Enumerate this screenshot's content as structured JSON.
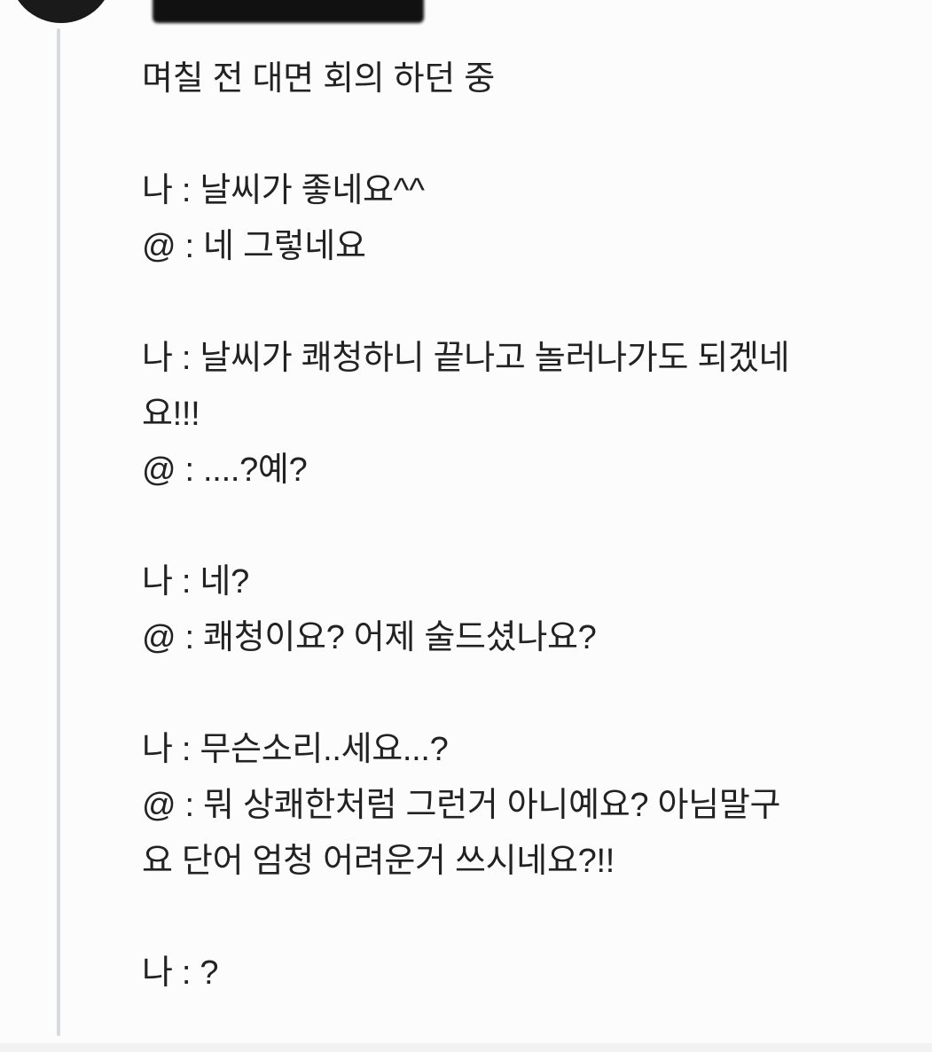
{
  "post": {
    "title": "며칠 전 대면 회의 하던 중",
    "lines": [
      "나 : 날씨가 좋네요^^",
      "@ : 네 그렇네요",
      "나 : 날씨가 쾌청하니 끝나고 놀러나가도 되겠네",
      "요!!!",
      "@ : ....?예?",
      "나 : 네?",
      "@ : 쾌청이요? 어제 술드셨나요?",
      "나 : 무슨소리..세요...?",
      "@ : 뭐 상쾌한처럼 그런거 아니예요? 아님말구",
      "요 단어 엄청 어려운거 쓰시네요?!!",
      "나 : ?"
    ]
  }
}
